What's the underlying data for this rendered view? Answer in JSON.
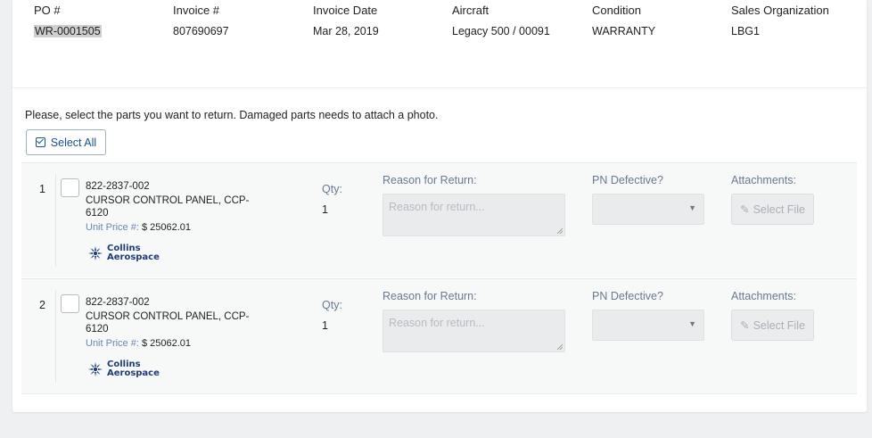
{
  "header": {
    "columns": [
      {
        "label": "PO #",
        "value": "WR-0001505"
      },
      {
        "label": "Invoice #",
        "value": "807690697"
      },
      {
        "label": "Invoice Date",
        "value": "Mar 28, 2019"
      },
      {
        "label": "Aircraft",
        "value": "Legacy 500 / 00091"
      },
      {
        "label": "Condition",
        "value": "WARRANTY"
      },
      {
        "label": "Sales Organization",
        "value": "LBG1"
      }
    ]
  },
  "instructions": "Please, select the parts you want to return. Damaged parts needs to attach a photo.",
  "select_all": {
    "label": "Select All",
    "icon": "check-square-icon"
  },
  "fields": {
    "qty_label": "Qty:",
    "reason_label": "Reason for Return:",
    "reason_placeholder": "Reason for return...",
    "defective_label": "PN Defective?",
    "attachments_label": "Attachments:",
    "select_file_label": "Select File",
    "unit_price_label": "Unit Price #:"
  },
  "parts": [
    {
      "index": "1",
      "part_number": "822-2837-002",
      "description": "CURSOR CONTROL PANEL, CCP-6120",
      "unit_price": "$ 25062.01",
      "qty": "1",
      "vendor_logo": {
        "line1": "Collins",
        "line2": "Aerospace"
      }
    },
    {
      "index": "2",
      "part_number": "822-2837-002",
      "description": "CURSOR CONTROL PANEL, CCP-6120",
      "unit_price": "$ 25062.01",
      "qty": "1",
      "vendor_logo": {
        "line1": "Collins",
        "line2": "Aerospace"
      }
    }
  ],
  "colors": {
    "accent": "#1a4f8b",
    "label_muted": "#6a7a8f",
    "price_label": "#6b87b3",
    "logo": "#1f3c7a"
  }
}
